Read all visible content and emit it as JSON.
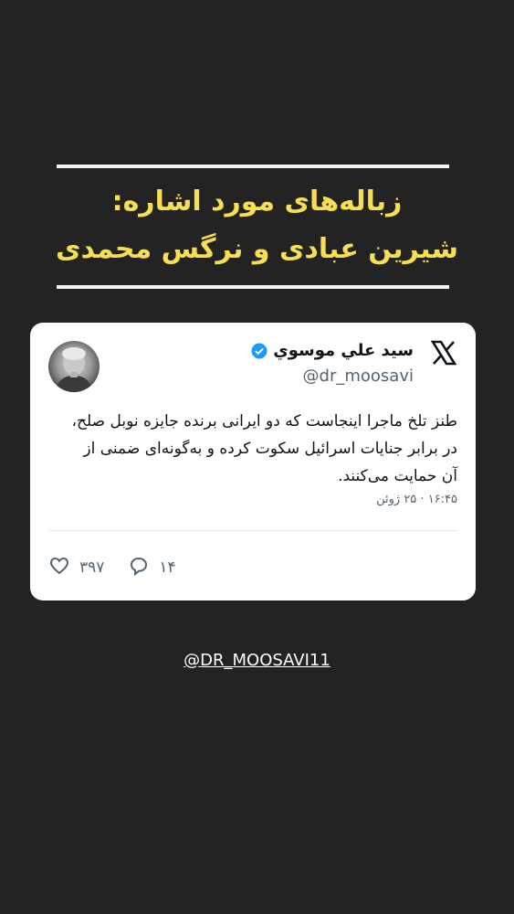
{
  "headline": {
    "line1": "زباله‌های مورد اشاره:",
    "line2": "شیرین عبادی و نرگس محمدی"
  },
  "tweet": {
    "author_name": "سید علي موسوي",
    "author_handle": "@dr_moosavi",
    "text": "طنز تلخ ماجرا اینجاست که دو ایرانی برنده جایزه نوبل صلح، در برابر جنایات اسرائیل سکوت کرده و به‌گونه‌ای ضمنی از آن حمایت می‌کنند.",
    "timestamp": "۱۶:۴۵ · ۲۵ ژوئن",
    "likes": "۳۹۷",
    "replies": "۱۴",
    "icons": {
      "brand": "x-logo-icon",
      "verified": "verified-badge-icon",
      "like": "heart-icon",
      "reply": "reply-bubble-icon"
    }
  },
  "footer": {
    "handle": "@DR_MOOSAVI11"
  },
  "colors": {
    "background": "#232323",
    "headline": "#f7de52",
    "rule": "#f4f4f4",
    "card": "#ffffff",
    "verified": "#1d9bf0",
    "muted_text": "#536471"
  }
}
